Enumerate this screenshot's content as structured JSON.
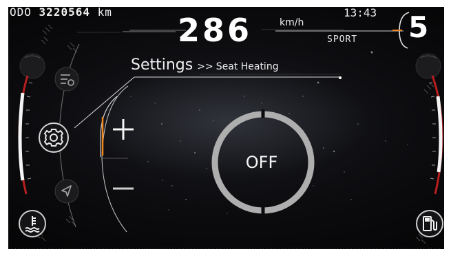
{
  "odometer": {
    "label": "ODO",
    "value": "3220564",
    "unit": "km"
  },
  "clock": "13:43",
  "speed": {
    "value": "286",
    "unit": "km/h"
  },
  "drive_mode": "SPORT",
  "gear": "5",
  "breadcrumb": {
    "title": "Settings",
    "separator": ">>",
    "current": "Seat Heating"
  },
  "seat_heating": {
    "state": "OFF",
    "level": 0
  },
  "icons": {
    "menu_top": "list-gear-icon",
    "menu_settings": "gear-icon",
    "menu_navigation": "navigation-arrow-icon",
    "coolant": "coolant-temperature-icon",
    "fuel": "fuel-pump-icon",
    "increase": "plus-icon",
    "decrease": "minus-icon"
  },
  "colors": {
    "accent": "#f0861e",
    "text": "#f2f2f2",
    "background": "#0b0b0e"
  }
}
